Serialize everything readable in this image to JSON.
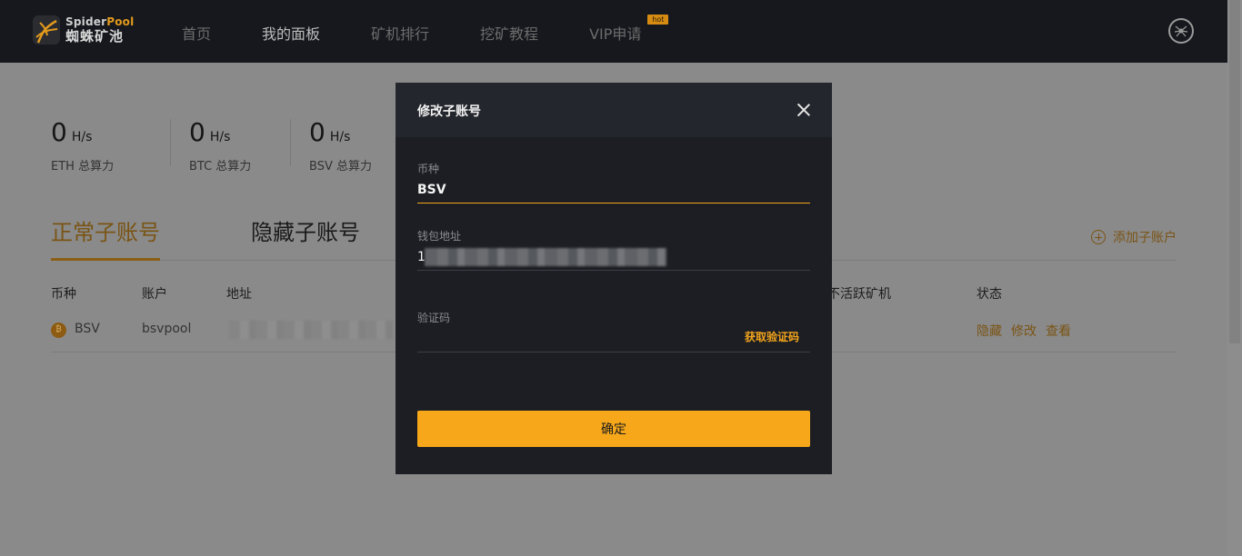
{
  "brand": {
    "name_en_a": "Spider",
    "name_en_b": "Pool",
    "name_cn": "蜘蛛矿池"
  },
  "nav": {
    "items": [
      {
        "label": "首页",
        "active": false
      },
      {
        "label": "我的面板",
        "active": true
      },
      {
        "label": "矿机排行",
        "active": false
      },
      {
        "label": "挖矿教程",
        "active": false
      },
      {
        "label": "VIP申请",
        "active": false
      }
    ],
    "hot_badge": "hot"
  },
  "stats": [
    {
      "value": "0",
      "unit": "H/s",
      "label": "ETH 总算力"
    },
    {
      "value": "0",
      "unit": "H/s",
      "label": "BTC 总算力"
    },
    {
      "value": "0",
      "unit": "H/s",
      "label": "BSV 总算力"
    }
  ],
  "tabs": {
    "normal": "正常子账号",
    "hidden": "隐藏子账号",
    "add_label": "添加子账户"
  },
  "table": {
    "headers": {
      "coin": "币种",
      "account": "账户",
      "address": "地址",
      "inactive": "不活跃矿机",
      "status": "状态"
    },
    "row": {
      "coin": "BSV",
      "account": "bsvpool",
      "ops": [
        "隐藏",
        "修改",
        "查看"
      ]
    }
  },
  "modal": {
    "title": "修改子账号",
    "coin_label": "币种",
    "coin_value": "BSV",
    "wallet_label": "钱包地址",
    "wallet_value": "1",
    "code_label": "验证码",
    "get_code": "获取验证码",
    "confirm": "确定"
  },
  "colors": {
    "accent": "#f7a81a",
    "modal_bg": "#1c1e23",
    "navbar_bg": "#16181d"
  }
}
